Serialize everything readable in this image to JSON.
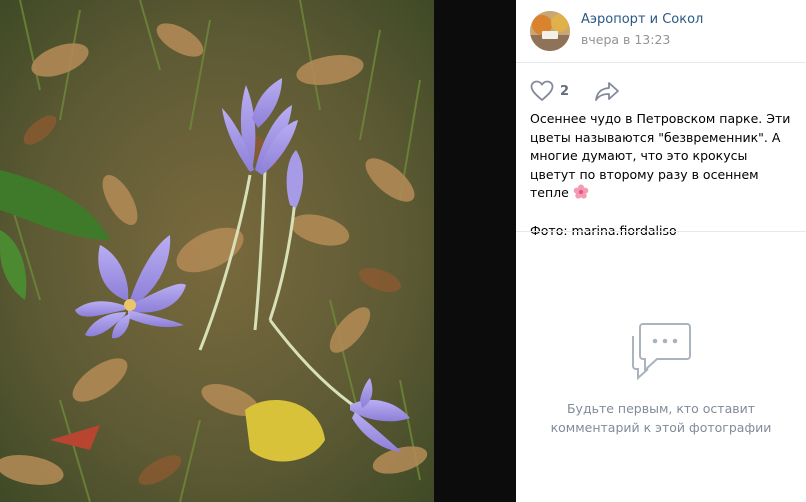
{
  "post": {
    "author": "Аэропорт и Сокол",
    "time": "вчера в 13:23",
    "likes": "2",
    "caption": "Осеннее чудо в Петровском парке. Эти цветы называются \"безвременник\". А многие думают, что это крокусы цветут по второму разу в осеннем тепле",
    "credit": "Фото: marina.fiordaliso"
  },
  "comments": {
    "empty_line1": "Будьте первым, кто оставит",
    "empty_line2": "комментарий к этой фотографии"
  },
  "icons": {
    "like": "heart-icon",
    "share": "share-arrow-icon",
    "caption_emoji": "flower-emoji-icon",
    "empty": "comment-bubble-icon"
  },
  "colors": {
    "link": "#2a5885",
    "meta": "#939393",
    "muted": "#818c99",
    "icon": "#aab3be"
  }
}
